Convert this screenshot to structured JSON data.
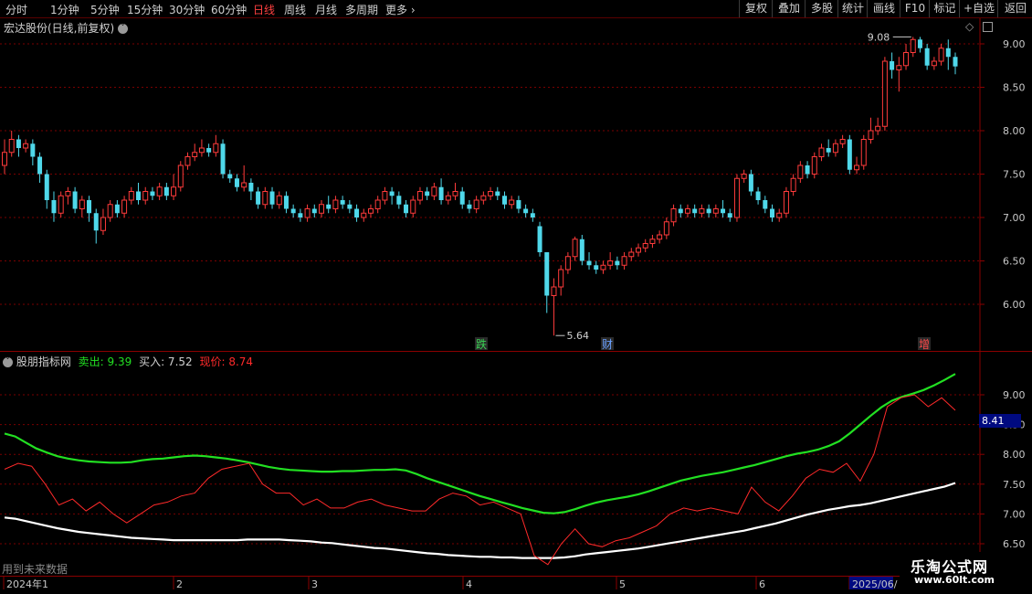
{
  "toolbar": {
    "periods": [
      "分时",
      "1分钟",
      "5分钟",
      "15分钟",
      "30分钟",
      "60分钟",
      "日线",
      "周线",
      "月线",
      "多周期",
      "更多"
    ],
    "active_period": "日线",
    "right_buttons": [
      "复权",
      "叠加",
      "多股",
      "统计",
      "画线",
      "F10",
      "标记",
      "+自选",
      "返回"
    ]
  },
  "main_chart": {
    "title": "宏达股份(日线,前复权)",
    "high_label": "9.08",
    "low_label": "5.64",
    "y_ticks": [
      "9.00",
      "8.50",
      "8.00",
      "7.50",
      "7.00",
      "6.50",
      "6.00"
    ],
    "event_markers": [
      {
        "text": "跌",
        "color": "#39d353"
      },
      {
        "text": "财",
        "color": "#6aa0ff"
      },
      {
        "text": "增",
        "color": "#ff4a4a"
      }
    ],
    "colors": {
      "up": "#ff3b3b",
      "down": "#4fd8ea",
      "grid": "#7a0000",
      "border": "#8a0000"
    }
  },
  "indicator": {
    "name": "股朋指标网",
    "sell_label": "卖出: 9.39",
    "buy_label": "买入: 7.52",
    "price_label": "现价: 8.74",
    "y_ticks": [
      "9.00",
      "8.50",
      "8.00",
      "7.50",
      "7.00",
      "6.50"
    ],
    "current_value": "8.41",
    "note": "用到未来数据",
    "colors": {
      "sell": "#22e022",
      "buy": "#ffffff",
      "price": "#ff2a2a"
    }
  },
  "date_axis": [
    "2024年1",
    "2",
    "3",
    "4",
    "5",
    "6",
    "2025/06/"
  ],
  "watermark": {
    "title": "乐淘公式网",
    "url": "www.60lt.com"
  },
  "chart_data": [
    {
      "type": "candlestick",
      "title": "宏达股份(日线,前复权)",
      "ylim": [
        5.5,
        9.4
      ],
      "y_ticks": [
        6.0,
        6.5,
        7.0,
        7.5,
        8.0,
        8.5,
        9.0
      ],
      "high": 9.08,
      "low": 5.64,
      "ohlc": [
        [
          7.6,
          7.75,
          7.9,
          7.5
        ],
        [
          7.75,
          7.9,
          8.0,
          7.7
        ],
        [
          7.9,
          7.8,
          7.95,
          7.7
        ],
        [
          7.8,
          7.85,
          7.9,
          7.75
        ],
        [
          7.85,
          7.7,
          7.9,
          7.6
        ],
        [
          7.7,
          7.5,
          7.75,
          7.4
        ],
        [
          7.5,
          7.2,
          7.55,
          7.1
        ],
        [
          7.2,
          7.05,
          7.3,
          6.95
        ],
        [
          7.05,
          7.25,
          7.3,
          7.0
        ],
        [
          7.25,
          7.3,
          7.35,
          7.15
        ],
        [
          7.3,
          7.1,
          7.35,
          7.05
        ],
        [
          7.1,
          7.2,
          7.25,
          7.0
        ],
        [
          7.2,
          7.05,
          7.25,
          6.95
        ],
        [
          7.05,
          6.85,
          7.1,
          6.7
        ],
        [
          6.85,
          7.0,
          7.1,
          6.8
        ],
        [
          7.0,
          7.15,
          7.2,
          6.95
        ],
        [
          7.15,
          7.05,
          7.2,
          7.0
        ],
        [
          7.05,
          7.2,
          7.25,
          7.0
        ],
        [
          7.2,
          7.3,
          7.35,
          7.15
        ],
        [
          7.3,
          7.2,
          7.4,
          7.15
        ],
        [
          7.2,
          7.3,
          7.35,
          7.15
        ],
        [
          7.3,
          7.25,
          7.35,
          7.2
        ],
        [
          7.25,
          7.35,
          7.4,
          7.2
        ],
        [
          7.35,
          7.25,
          7.4,
          7.2
        ],
        [
          7.25,
          7.35,
          7.5,
          7.2
        ],
        [
          7.35,
          7.6,
          7.65,
          7.3
        ],
        [
          7.6,
          7.7,
          7.75,
          7.55
        ],
        [
          7.7,
          7.75,
          7.85,
          7.65
        ],
        [
          7.75,
          7.8,
          7.9,
          7.7
        ],
        [
          7.8,
          7.75,
          7.85,
          7.7
        ],
        [
          7.75,
          7.85,
          7.95,
          7.7
        ],
        [
          7.85,
          7.5,
          7.9,
          7.45
        ],
        [
          7.5,
          7.45,
          7.55,
          7.4
        ],
        [
          7.45,
          7.35,
          7.5,
          7.3
        ],
        [
          7.35,
          7.4,
          7.6,
          7.3
        ],
        [
          7.4,
          7.3,
          7.45,
          7.2
        ],
        [
          7.3,
          7.15,
          7.35,
          7.1
        ],
        [
          7.15,
          7.3,
          7.35,
          7.1
        ],
        [
          7.3,
          7.15,
          7.35,
          7.1
        ],
        [
          7.15,
          7.25,
          7.3,
          7.1
        ],
        [
          7.25,
          7.1,
          7.3,
          7.05
        ],
        [
          7.1,
          7.05,
          7.15,
          7.0
        ],
        [
          7.05,
          7.0,
          7.1,
          6.95
        ],
        [
          7.0,
          7.1,
          7.15,
          6.95
        ],
        [
          7.1,
          7.05,
          7.15,
          7.0
        ],
        [
          7.05,
          7.15,
          7.2,
          7.0
        ],
        [
          7.15,
          7.1,
          7.25,
          7.05
        ],
        [
          7.1,
          7.2,
          7.25,
          7.05
        ],
        [
          7.2,
          7.15,
          7.25,
          7.1
        ],
        [
          7.15,
          7.1,
          7.2,
          7.05
        ],
        [
          7.1,
          7.0,
          7.15,
          6.95
        ],
        [
          7.0,
          7.05,
          7.1,
          6.95
        ],
        [
          7.05,
          7.1,
          7.15,
          7.0
        ],
        [
          7.1,
          7.2,
          7.25,
          7.05
        ],
        [
          7.2,
          7.3,
          7.35,
          7.15
        ],
        [
          7.3,
          7.25,
          7.35,
          7.15
        ],
        [
          7.25,
          7.15,
          7.3,
          7.1
        ],
        [
          7.15,
          7.05,
          7.2,
          7.0
        ],
        [
          7.05,
          7.2,
          7.25,
          7.0
        ],
        [
          7.2,
          7.3,
          7.35,
          7.15
        ],
        [
          7.3,
          7.25,
          7.35,
          7.2
        ],
        [
          7.25,
          7.35,
          7.4,
          7.2
        ],
        [
          7.35,
          7.2,
          7.45,
          7.15
        ],
        [
          7.2,
          7.25,
          7.3,
          7.15
        ],
        [
          7.25,
          7.3,
          7.4,
          7.2
        ],
        [
          7.3,
          7.15,
          7.35,
          7.1
        ],
        [
          7.15,
          7.1,
          7.2,
          7.05
        ],
        [
          7.1,
          7.2,
          7.25,
          7.05
        ],
        [
          7.2,
          7.25,
          7.3,
          7.15
        ],
        [
          7.25,
          7.3,
          7.35,
          7.2
        ],
        [
          7.3,
          7.25,
          7.35,
          7.2
        ],
        [
          7.25,
          7.15,
          7.3,
          7.1
        ],
        [
          7.15,
          7.2,
          7.25,
          7.1
        ],
        [
          7.2,
          7.1,
          7.25,
          7.05
        ],
        [
          7.1,
          7.05,
          7.15,
          7.0
        ],
        [
          7.05,
          7.0,
          7.1,
          6.95
        ],
        [
          6.9,
          6.6,
          6.95,
          6.55
        ],
        [
          6.6,
          6.1,
          6.3,
          5.9
        ],
        [
          6.1,
          6.2,
          6.3,
          5.64
        ],
        [
          6.2,
          6.4,
          6.45,
          6.1
        ],
        [
          6.4,
          6.55,
          6.6,
          6.35
        ],
        [
          6.55,
          6.75,
          6.78,
          6.5
        ],
        [
          6.75,
          6.5,
          6.8,
          6.45
        ],
        [
          6.5,
          6.45,
          6.6,
          6.4
        ],
        [
          6.45,
          6.4,
          6.5,
          6.35
        ],
        [
          6.4,
          6.45,
          6.5,
          6.35
        ],
        [
          6.45,
          6.5,
          6.6,
          6.4
        ],
        [
          6.5,
          6.45,
          6.55,
          6.4
        ],
        [
          6.45,
          6.55,
          6.6,
          6.4
        ],
        [
          6.55,
          6.6,
          6.65,
          6.5
        ],
        [
          6.6,
          6.65,
          6.7,
          6.55
        ],
        [
          6.65,
          6.7,
          6.75,
          6.6
        ],
        [
          6.7,
          6.75,
          6.8,
          6.65
        ],
        [
          6.75,
          6.8,
          6.85,
          6.7
        ],
        [
          6.8,
          6.95,
          7.0,
          6.75
        ],
        [
          6.95,
          7.1,
          7.15,
          6.9
        ],
        [
          7.1,
          7.05,
          7.15,
          7.0
        ],
        [
          7.05,
          7.1,
          7.15,
          7.0
        ],
        [
          7.1,
          7.05,
          7.15,
          7.0
        ],
        [
          7.05,
          7.1,
          7.15,
          7.0
        ],
        [
          7.1,
          7.05,
          7.15,
          7.0
        ],
        [
          7.05,
          7.1,
          7.15,
          7.0
        ],
        [
          7.1,
          7.05,
          7.2,
          7.0
        ],
        [
          7.05,
          7.0,
          7.1,
          6.95
        ],
        [
          7.0,
          7.45,
          7.5,
          6.95
        ],
        [
          7.45,
          7.5,
          7.55,
          7.4
        ],
        [
          7.5,
          7.3,
          7.55,
          7.25
        ],
        [
          7.3,
          7.2,
          7.35,
          7.15
        ],
        [
          7.2,
          7.1,
          7.25,
          7.05
        ],
        [
          7.1,
          7.0,
          7.15,
          6.95
        ],
        [
          7.0,
          7.05,
          7.1,
          6.95
        ],
        [
          7.05,
          7.3,
          7.35,
          7.0
        ],
        [
          7.3,
          7.45,
          7.5,
          7.25
        ],
        [
          7.45,
          7.6,
          7.65,
          7.4
        ],
        [
          7.6,
          7.5,
          7.65,
          7.45
        ],
        [
          7.5,
          7.7,
          7.75,
          7.45
        ],
        [
          7.7,
          7.8,
          7.85,
          7.65
        ],
        [
          7.8,
          7.75,
          7.9,
          7.7
        ],
        [
          7.75,
          7.85,
          7.9,
          7.7
        ],
        [
          7.85,
          7.9,
          7.95,
          7.8
        ],
        [
          7.9,
          7.55,
          7.95,
          7.5
        ],
        [
          7.55,
          7.6,
          7.7,
          7.5
        ],
        [
          7.6,
          7.9,
          7.95,
          7.55
        ],
        [
          7.9,
          8.0,
          8.15,
          7.85
        ],
        [
          8.0,
          8.05,
          8.15,
          7.95
        ],
        [
          8.05,
          8.8,
          8.85,
          8.0
        ],
        [
          8.8,
          8.7,
          8.9,
          8.6
        ],
        [
          8.7,
          8.75,
          8.85,
          8.45
        ],
        [
          8.75,
          8.9,
          9.0,
          8.7
        ],
        [
          8.9,
          9.05,
          9.08,
          8.85
        ],
        [
          9.05,
          8.95,
          9.08,
          8.9
        ],
        [
          8.95,
          8.75,
          9.0,
          8.7
        ],
        [
          8.75,
          8.8,
          8.85,
          8.7
        ],
        [
          8.8,
          8.95,
          9.0,
          8.75
        ],
        [
          8.95,
          8.85,
          9.05,
          8.7
        ],
        [
          8.85,
          8.74,
          8.9,
          8.65
        ]
      ]
    },
    {
      "type": "line",
      "title": "股朋指标网",
      "ylim": [
        6.45,
        9.6
      ],
      "y_ticks": [
        6.5,
        7.0,
        7.5,
        8.0,
        8.5,
        9.0
      ],
      "series": [
        {
          "name": "卖出",
          "color": "#22e022",
          "values": [
            8.35,
            8.3,
            8.2,
            8.1,
            8.03,
            7.97,
            7.93,
            7.9,
            7.88,
            7.87,
            7.86,
            7.86,
            7.87,
            7.9,
            7.92,
            7.93,
            7.95,
            7.97,
            7.98,
            7.97,
            7.95,
            7.93,
            7.9,
            7.87,
            7.83,
            7.79,
            7.76,
            7.74,
            7.73,
            7.72,
            7.71,
            7.71,
            7.72,
            7.72,
            7.73,
            7.74,
            7.74,
            7.75,
            7.73,
            7.67,
            7.6,
            7.54,
            7.48,
            7.42,
            7.36,
            7.3,
            7.25,
            7.2,
            7.15,
            7.1,
            7.06,
            7.02,
            7.01,
            7.03,
            7.08,
            7.14,
            7.19,
            7.23,
            7.26,
            7.29,
            7.33,
            7.38,
            7.44,
            7.5,
            7.56,
            7.6,
            7.64,
            7.67,
            7.7,
            7.74,
            7.78,
            7.82,
            7.87,
            7.92,
            7.97,
            8.01,
            8.04,
            8.08,
            8.14,
            8.22,
            8.35,
            8.5,
            8.65,
            8.79,
            8.9,
            8.97,
            9.02,
            9.08,
            9.16,
            9.25,
            9.35
          ]
        },
        {
          "name": "买入",
          "color": "#ffffff",
          "values": [
            6.94,
            6.92,
            6.88,
            6.84,
            6.8,
            6.76,
            6.73,
            6.7,
            6.68,
            6.66,
            6.64,
            6.62,
            6.6,
            6.59,
            6.58,
            6.57,
            6.56,
            6.56,
            6.56,
            6.56,
            6.56,
            6.56,
            6.56,
            6.57,
            6.57,
            6.57,
            6.57,
            6.56,
            6.55,
            6.54,
            6.52,
            6.51,
            6.49,
            6.47,
            6.45,
            6.43,
            6.42,
            6.4,
            6.38,
            6.36,
            6.34,
            6.33,
            6.31,
            6.3,
            6.29,
            6.28,
            6.28,
            6.27,
            6.27,
            6.26,
            6.26,
            6.26,
            6.26,
            6.27,
            6.29,
            6.32,
            6.34,
            6.36,
            6.38,
            6.4,
            6.42,
            6.45,
            6.48,
            6.51,
            6.54,
            6.57,
            6.6,
            6.63,
            6.66,
            6.69,
            6.72,
            6.76,
            6.8,
            6.84,
            6.89,
            6.94,
            6.99,
            7.03,
            7.07,
            7.1,
            7.13,
            7.15,
            7.18,
            7.22,
            7.26,
            7.3,
            7.34,
            7.38,
            7.42,
            7.46,
            7.52
          ]
        },
        {
          "name": "现价",
          "color": "#ff2a2a",
          "values": [
            7.75,
            7.85,
            7.8,
            7.5,
            7.15,
            7.25,
            7.05,
            7.2,
            7.0,
            6.85,
            7.0,
            7.15,
            7.2,
            7.3,
            7.35,
            7.6,
            7.75,
            7.8,
            7.85,
            7.5,
            7.35,
            7.35,
            7.15,
            7.25,
            7.1,
            7.1,
            7.2,
            7.25,
            7.15,
            7.1,
            7.05,
            7.05,
            7.25,
            7.35,
            7.3,
            7.15,
            7.2,
            7.1,
            7.0,
            6.3,
            6.15,
            6.5,
            6.75,
            6.5,
            6.45,
            6.55,
            6.6,
            6.7,
            6.8,
            7.0,
            7.1,
            7.05,
            7.1,
            7.05,
            7.0,
            7.45,
            7.2,
            7.05,
            7.3,
            7.6,
            7.75,
            7.7,
            7.85,
            7.55,
            8.0,
            8.8,
            8.95,
            9.0,
            8.8,
            8.95,
            8.74
          ]
        }
      ]
    }
  ]
}
